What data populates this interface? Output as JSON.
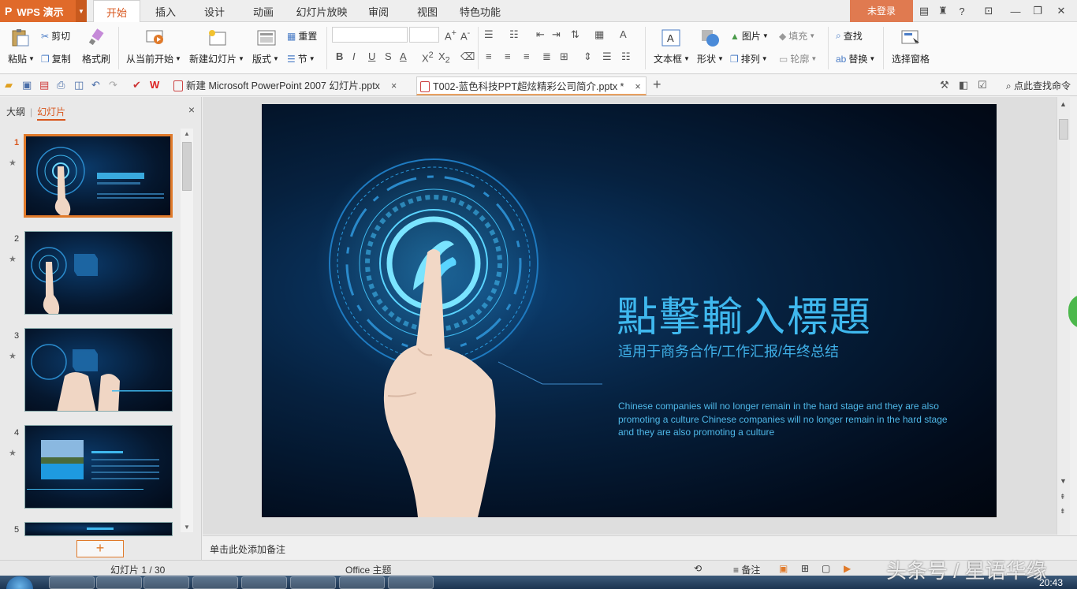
{
  "app": {
    "name": "WPS 演示"
  },
  "menu": {
    "tabs": [
      "开始",
      "插入",
      "设计",
      "动画",
      "幻灯片放映",
      "审阅",
      "视图",
      "特色功能"
    ],
    "login": "未登录",
    "help": "?"
  },
  "ribbon": {
    "paste": "粘贴",
    "cut": "剪切",
    "copy": "复制",
    "format_painter": "格式刷",
    "from_current": "从当前开始",
    "new_slide": "新建幻灯片",
    "layout": "版式",
    "reset": "重置",
    "section": "节",
    "textbox": "文本框",
    "shape": "形状",
    "picture": "图片",
    "fill": "填充",
    "arrange": "排列",
    "outline": "轮廓",
    "find": "查找",
    "replace": "替换",
    "selection_pane": "选择窗格"
  },
  "doc_tabs": [
    {
      "title": "新建 Microsoft PowerPoint 2007 幻灯片.pptx",
      "close": "×"
    },
    {
      "title": "T002-蓝色科技PPT超炫精彩公司简介.pptx *",
      "close": "×"
    }
  ],
  "new_tab": "+",
  "find_command": "点此查找命令",
  "left_panel": {
    "tab_outline": "大纲",
    "tab_slides": "幻灯片",
    "close": "×",
    "thumbnails": [
      {
        "num": "1"
      },
      {
        "num": "2"
      },
      {
        "num": "3"
      },
      {
        "num": "4"
      },
      {
        "num": "5"
      }
    ],
    "add_button": "+"
  },
  "slide": {
    "title": "點擊輸入標題",
    "subtitle": "适用于商务合作/工作汇报/年终总结",
    "body": "Chinese  companies  will no longer remain in the hard stage and they are also promoting a culture Chinese  companies  will no longer remain in the hard stage and they are also promoting a culture"
  },
  "notes_placeholder": "单击此处添加备注",
  "status": {
    "slide_count": "幻灯片 1 / 30",
    "theme": "Office 主题",
    "notes": "备注"
  },
  "taskbar": {
    "clock": "20:43"
  },
  "watermark": "头条号 / 星语华缘",
  "colors": {
    "accent": "#e06a2a",
    "slide_text": "#3fb8ee",
    "login": "#e07a50"
  }
}
